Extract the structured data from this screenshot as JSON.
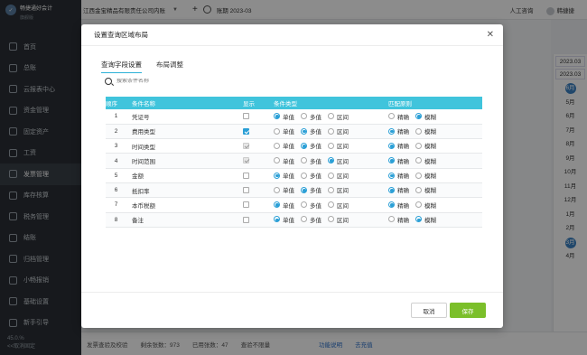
{
  "sidebar": {
    "brand_line1": "畅捷通好会计",
    "brand_line2": "旗舰版",
    "items": [
      {
        "label": "首页",
        "icon": "home-icon"
      },
      {
        "label": "总账",
        "icon": "ledger-icon"
      },
      {
        "label": "云报表中心",
        "icon": "report-icon"
      },
      {
        "label": "资金管理",
        "icon": "money-icon"
      },
      {
        "label": "固定资产",
        "icon": "asset-icon"
      },
      {
        "label": "工资",
        "icon": "salary-icon"
      },
      {
        "label": "发票管理",
        "icon": "invoice-icon"
      },
      {
        "label": "库存核算",
        "icon": "inventory-icon"
      },
      {
        "label": "税务管理",
        "icon": "tax-icon"
      },
      {
        "label": "结账",
        "icon": "close-book-icon"
      },
      {
        "label": "归档管理",
        "icon": "archive-icon"
      },
      {
        "label": "小畅报销",
        "icon": "expense-icon"
      },
      {
        "label": "基础设置",
        "icon": "settings-icon"
      },
      {
        "label": "新手引导",
        "icon": "guide-icon"
      }
    ],
    "bottom_line1": "45.0.%",
    "bottom_line2": "<<取消固定"
  },
  "topbar": {
    "company": "江西金宝精品有限责任公司内账",
    "period": "账期 2023-03",
    "service": "人工咨询",
    "user": "韩捷捷"
  },
  "right_panel": {
    "year1": "2023.03",
    "year2": "2023.03",
    "months": [
      "6月",
      "5月",
      "6月",
      "7月",
      "8月",
      "9月",
      "10月",
      "11月",
      "12月",
      "1月",
      "2月",
      "3月",
      "4月"
    ],
    "highlight": [
      0,
      11
    ]
  },
  "footer": {
    "item1": "发票查验及校验",
    "item2": "剩余张数：973",
    "item3": "已用张数：47",
    "item4": "查验不限量",
    "link1": "功能说明",
    "link2": "去充值"
  },
  "modal": {
    "title": "设置查询区域布局",
    "tabs": [
      "查询字段设置",
      "布局调整"
    ],
    "search_placeholder": "搜索条件名称",
    "columns": [
      "顺序",
      "条件名称",
      "显示",
      "条件类型",
      "匹配原则"
    ],
    "type_options": [
      "单值",
      "多值",
      "区间"
    ],
    "match_options": [
      "精确",
      "模糊"
    ],
    "rows": [
      {
        "seq": "1",
        "name": "凭证号",
        "show": "off",
        "type": 0,
        "match": 1
      },
      {
        "seq": "2",
        "name": "费用类型",
        "show": "on",
        "type": 1,
        "match": 0
      },
      {
        "seq": "3",
        "name": "时间类型",
        "show": "disabled",
        "type": 1,
        "match": 0
      },
      {
        "seq": "4",
        "name": "时间范围",
        "show": "disabled",
        "type": 2,
        "match": 0
      },
      {
        "seq": "5",
        "name": "金额",
        "show": "off",
        "type": 0,
        "match": 0
      },
      {
        "seq": "6",
        "name": "抵扣率",
        "show": "off",
        "type": 1,
        "match": 0
      },
      {
        "seq": "7",
        "name": "本币税额",
        "show": "off",
        "type": 0,
        "match": 0
      },
      {
        "seq": "8",
        "name": "备注",
        "show": "off",
        "type": 0,
        "match": 1
      }
    ],
    "cancel_label": "取消",
    "save_label": "保存"
  }
}
